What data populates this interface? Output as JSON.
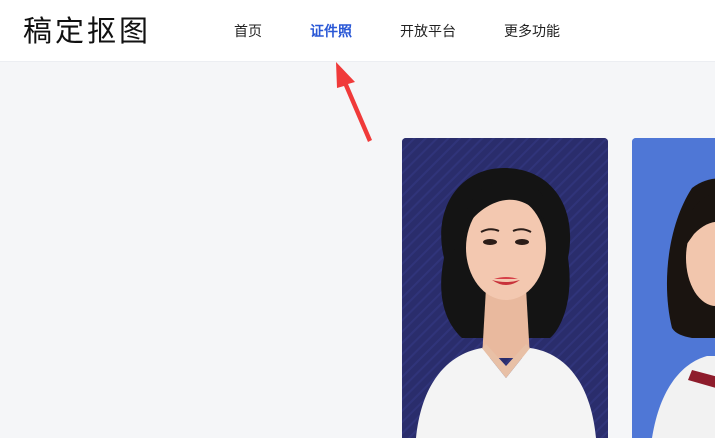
{
  "header": {
    "logo_text": "稿定抠图",
    "nav": [
      {
        "label": "首页",
        "active": false
      },
      {
        "label": "证件照",
        "active": true
      },
      {
        "label": "开放平台",
        "active": false
      },
      {
        "label": "更多功能",
        "active": false
      }
    ]
  },
  "colors": {
    "accent": "#2a58d6",
    "arrow": "#f03a3a",
    "page_background": "#f5f6f8",
    "card_1_background": "#2a2d6c",
    "card_2_background": "#4f77d6"
  },
  "gallery": {
    "cards": [
      {
        "background_name": "navy-blue"
      },
      {
        "background_name": "light-blue"
      }
    ]
  }
}
